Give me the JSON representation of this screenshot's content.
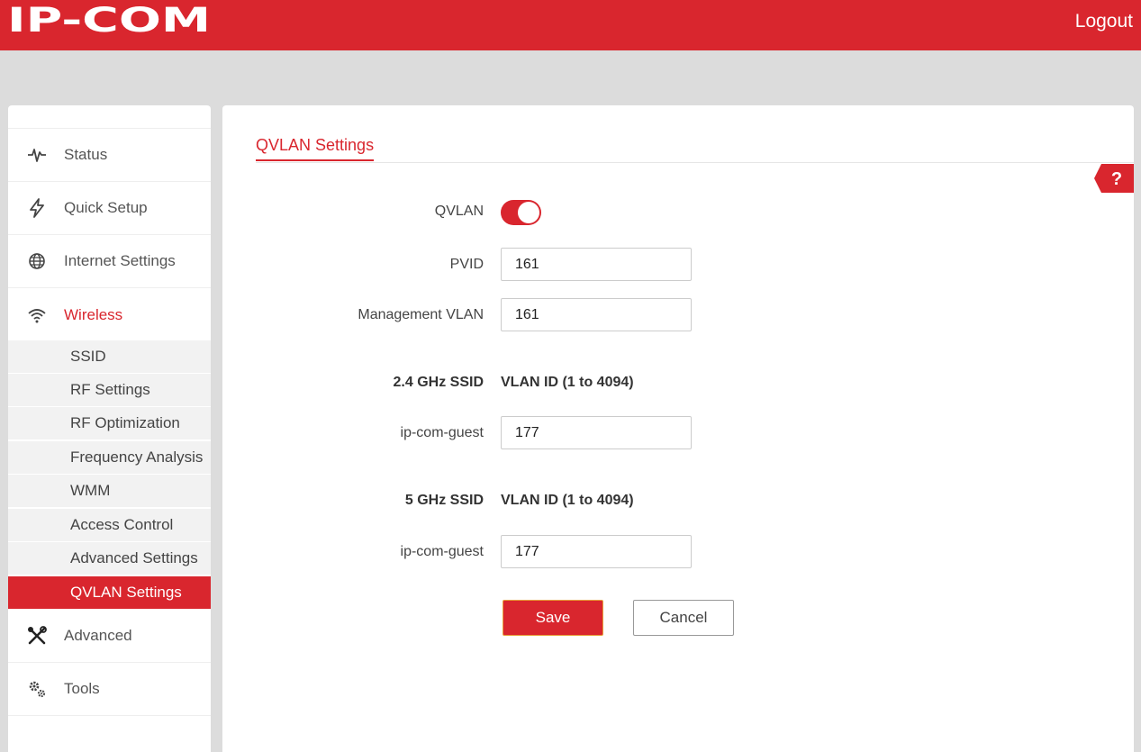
{
  "header": {
    "brand": "IP-COM",
    "logout_label": "Logout"
  },
  "sidebar": {
    "items": [
      {
        "label": "Status",
        "icon": "pulse-icon"
      },
      {
        "label": "Quick Setup",
        "icon": "lightning-icon"
      },
      {
        "label": "Internet Settings",
        "icon": "globe-icon"
      },
      {
        "label": "Wireless",
        "icon": "wifi-icon",
        "active": true
      },
      {
        "label": "Advanced",
        "icon": "tools-icon"
      },
      {
        "label": "Tools",
        "icon": "gears-icon"
      }
    ],
    "wireless_subitems": [
      {
        "label": "SSID"
      },
      {
        "label": "RF Settings"
      },
      {
        "label": "RF Optimization"
      },
      {
        "label": "Frequency Analysis"
      },
      {
        "label": "WMM"
      },
      {
        "label": "Access Control"
      },
      {
        "label": "Advanced Settings"
      },
      {
        "label": "QVLAN Settings",
        "selected": true
      }
    ]
  },
  "main": {
    "title": "QVLAN Settings",
    "help_label": "?",
    "qvlan": {
      "label": "QVLAN",
      "enabled": true
    },
    "pvid": {
      "label": "PVID",
      "value": "161"
    },
    "management_vlan": {
      "label": "Management VLAN",
      "value": "161"
    },
    "band_24": {
      "ssid_header": "2.4 GHz SSID",
      "vlan_header": "VLAN ID (1 to 4094)",
      "ssid": "ip-com-guest",
      "vlan_id": "177"
    },
    "band_5": {
      "ssid_header": "5 GHz SSID",
      "vlan_header": "VLAN ID (1 to 4094)",
      "ssid": "ip-com-guest",
      "vlan_id": "177"
    },
    "save_label": "Save",
    "cancel_label": "Cancel"
  },
  "colors": {
    "brand_red": "#d9262e",
    "background": "#dcdcdc",
    "submenu_bg": "#f2f2f2"
  }
}
